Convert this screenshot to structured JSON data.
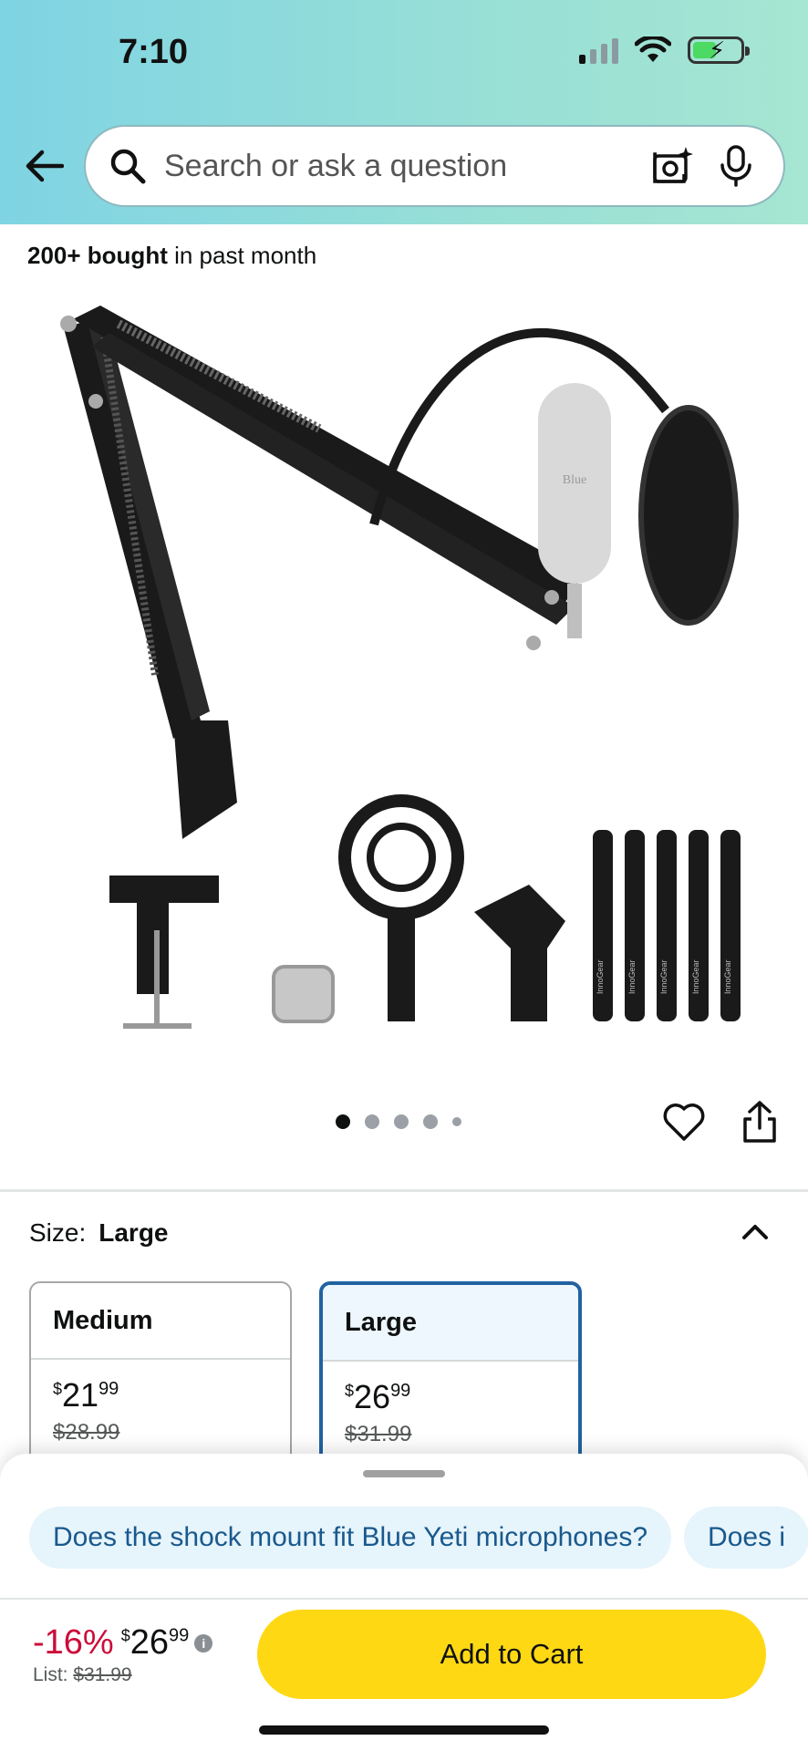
{
  "status_bar": {
    "time": "7:10"
  },
  "search": {
    "placeholder": "Search or ask a question"
  },
  "product": {
    "bought_bold": "200+ bought",
    "bought_rest": " in past month",
    "accessory_brand": "InnoGear",
    "mic_brand": "Blue"
  },
  "carousel": {
    "total": 5,
    "active_index": 0
  },
  "size": {
    "label": "Size:",
    "selected": "Large",
    "options": [
      {
        "name": "Medium",
        "currency": "$",
        "whole": "21",
        "cents": "99",
        "list": "$28.99"
      },
      {
        "name": "Large",
        "currency": "$",
        "whole": "26",
        "cents": "99",
        "list": "$31.99"
      }
    ]
  },
  "questions": [
    "Does the shock mount fit Blue Yeti microphones?",
    "Does i"
  ],
  "buy_box": {
    "discount": "-16%",
    "currency": "$",
    "whole": "26",
    "cents": "99",
    "info_glyph": "i",
    "list_label": "List:",
    "list_price": "$31.99",
    "add_to_cart": "Add to Cart"
  },
  "colors": {
    "accent_yellow": "#ffd814",
    "discount_red": "#cc0c39",
    "link_blue": "#19598d",
    "selected_border": "#2162a1"
  }
}
